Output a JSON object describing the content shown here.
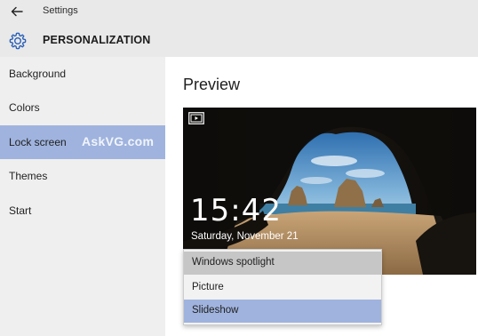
{
  "window": {
    "title": "Settings"
  },
  "header": {
    "title": "PERSONALIZATION"
  },
  "sidebar": {
    "items": [
      {
        "label": "Background"
      },
      {
        "label": "Colors"
      },
      {
        "label": "Lock screen"
      },
      {
        "label": "Themes"
      },
      {
        "label": "Start"
      }
    ],
    "active_index": 2,
    "watermark": "AskVG.com"
  },
  "main": {
    "preview_title": "Preview",
    "preview": {
      "time": "15:42",
      "date": "Saturday, November 21"
    },
    "dropdown": {
      "options": [
        {
          "label": "Windows spotlight"
        },
        {
          "label": "Picture"
        },
        {
          "label": "Slideshow"
        }
      ],
      "hover_index": 0,
      "selected_index": 2
    }
  },
  "colors": {
    "accent": "#9fb3de",
    "chrome": "#e9e9e9",
    "sidebar": "#efefef",
    "hover": "#c6c6c6"
  },
  "icons": {
    "back": "arrow-left-icon",
    "settings": "gear-icon",
    "slideshow": "slideshow-icon"
  }
}
